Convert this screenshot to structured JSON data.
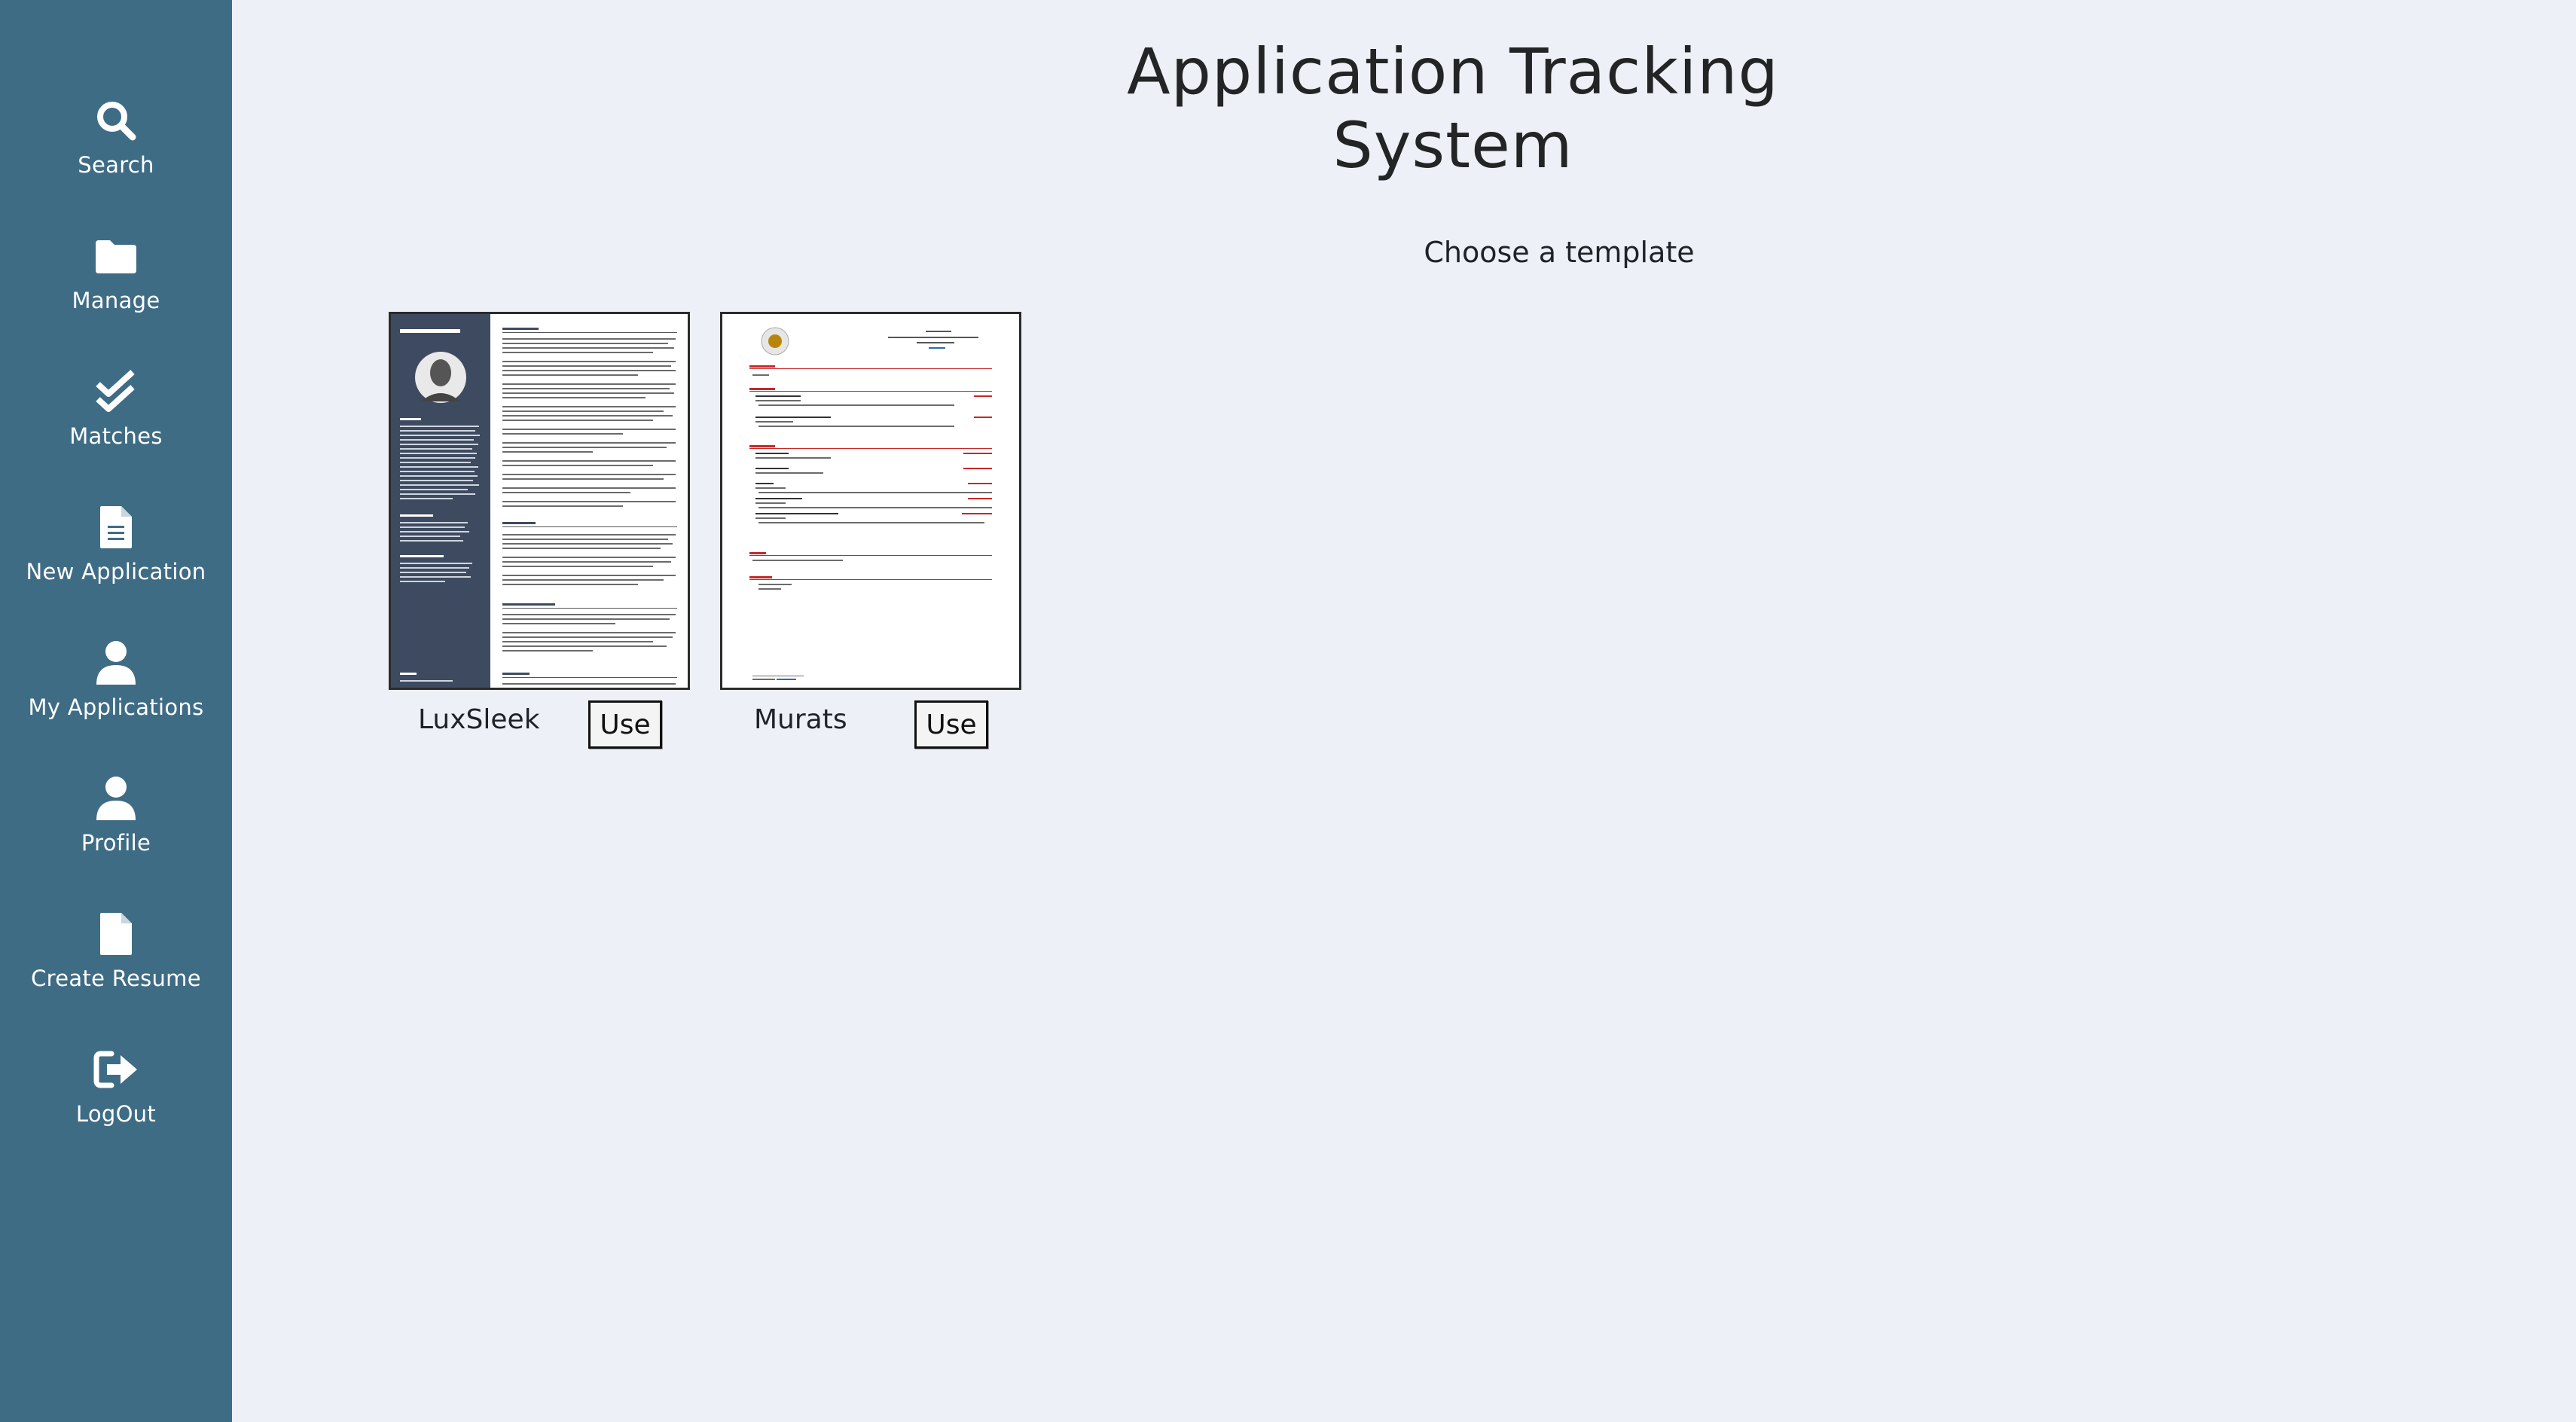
{
  "sidebar": {
    "items": [
      {
        "label": "Search",
        "icon": "search-icon"
      },
      {
        "label": "Manage",
        "icon": "folder-icon"
      },
      {
        "label": "Matches",
        "icon": "double-check-icon"
      },
      {
        "label": "New Application",
        "icon": "document-icon"
      },
      {
        "label": "My Applications",
        "icon": "user-icon"
      },
      {
        "label": "Profile",
        "icon": "user-icon"
      },
      {
        "label": "Create Resume",
        "icon": "blank-document-icon"
      },
      {
        "label": "LogOut",
        "icon": "logout-icon"
      }
    ]
  },
  "header": {
    "title": "Application Tracking System"
  },
  "main": {
    "choose_label": "Choose a template",
    "templates": [
      {
        "name": "LuxSleek",
        "button": "Use"
      },
      {
        "name": "Murats",
        "button": "Use"
      }
    ]
  },
  "colors": {
    "sidebar": "#3f6c85",
    "background": "#edf0f6",
    "luxsleek_sidebar": "#3e4a5f",
    "murats_accent": "#c62828"
  }
}
